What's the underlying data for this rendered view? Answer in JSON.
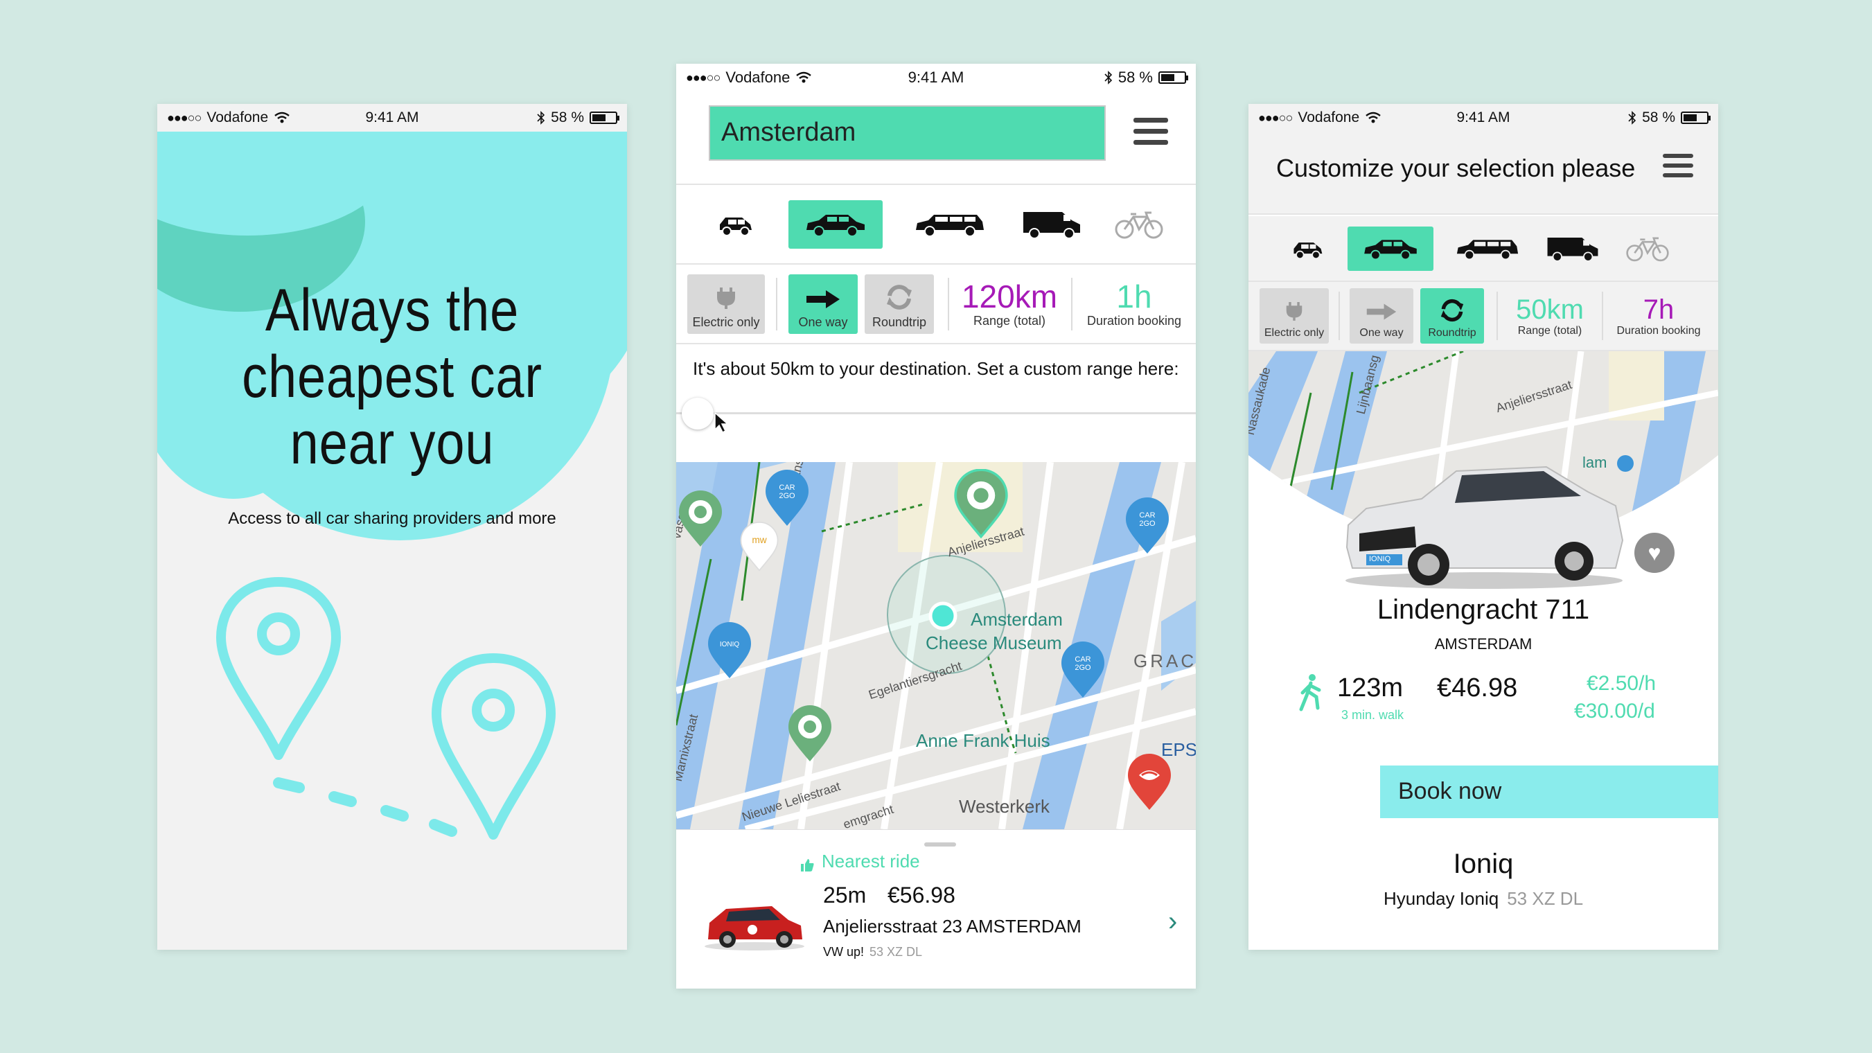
{
  "status": {
    "carrier": "Vodafone",
    "time": "9:41 AM",
    "battery": "58 %",
    "battery_level": 0.58
  },
  "screen1": {
    "headline_lines": [
      "Always the",
      "cheapest car",
      "near you"
    ],
    "subline": "Access to all car sharing providers and more"
  },
  "screen2": {
    "search_value": "Amsterdam",
    "filters": {
      "electric": "Electric only",
      "oneway": "One way",
      "roundtrip": "Roundtrip"
    },
    "range": {
      "value": "120km",
      "label": "Range (total)"
    },
    "duration": {
      "value": "1h",
      "label": "Duration booking"
    },
    "range_prompt": "It's about 50km to your destination. Set a custom range here:",
    "map_labels": {
      "museum": "Amsterdam Cheese Museum",
      "anne_frank": "Anne Frank Huis",
      "westerkerk": "Westerkerk",
      "grac": "GRAC",
      "eps": "EPS",
      "anjeliersstraat": "Anjeliersstraat",
      "egelantiersgracht": "Egelantiersgracht",
      "lijnbaansgracht": "Lijnbaansgracht",
      "marnixstraat": "Marnixstraat",
      "nieuwe_leliestraat": "Nieuwe Leliestraat",
      "emgracht": "emgracht",
      "vassa": "vassa"
    },
    "nearest": {
      "heading": "Nearest ride",
      "distance": "25m",
      "price": "€56.98",
      "address": "Anjeliersstraat 23 AMSTERDAM",
      "model": "VW up!",
      "plate": "53 XZ DL"
    }
  },
  "screen3": {
    "title": "Customize your selection please",
    "filters": {
      "electric": "Electric only",
      "oneway": "One way",
      "roundtrip": "Roundtrip"
    },
    "range": {
      "value": "50km",
      "label": "Range (total)"
    },
    "duration": {
      "value": "7h",
      "label": "Duration booking"
    },
    "map_labels": {
      "anjeliersstraat": "Anjeliersstraat",
      "lijnbaansg": "Lijnbaansg",
      "nassaukade": "Nassaukade",
      "lam": "lam"
    },
    "location": "Lindengracht 711",
    "city": "AMSTERDAM",
    "walk_distance": "123m",
    "walk_time": "3 min. walk",
    "price": "€46.98",
    "rate_hour": "€2.50/h",
    "rate_day": "€30.00/d",
    "book_label": "Book now",
    "car_name": "Ioniq",
    "car_model": "Hyunday Ioniq",
    "car_plate": "53 XZ DL",
    "car_badge": "IONIQ"
  },
  "colors": {
    "accent": "#4fdbb0",
    "cyan": "#8aecec",
    "purple": "#a61ab7",
    "background": "#d2e9e3"
  },
  "icons": [
    "wifi-icon",
    "bluetooth-icon",
    "battery-icon",
    "hamburger-icon",
    "car-small-icon",
    "car-sedan-icon",
    "car-wagon-icon",
    "van-icon",
    "bike-icon",
    "plug-icon",
    "arrow-right-icon",
    "refresh-icon",
    "thumbs-up-icon",
    "chevron-right-icon",
    "heart-icon",
    "walk-icon",
    "location-pin-icon"
  ]
}
